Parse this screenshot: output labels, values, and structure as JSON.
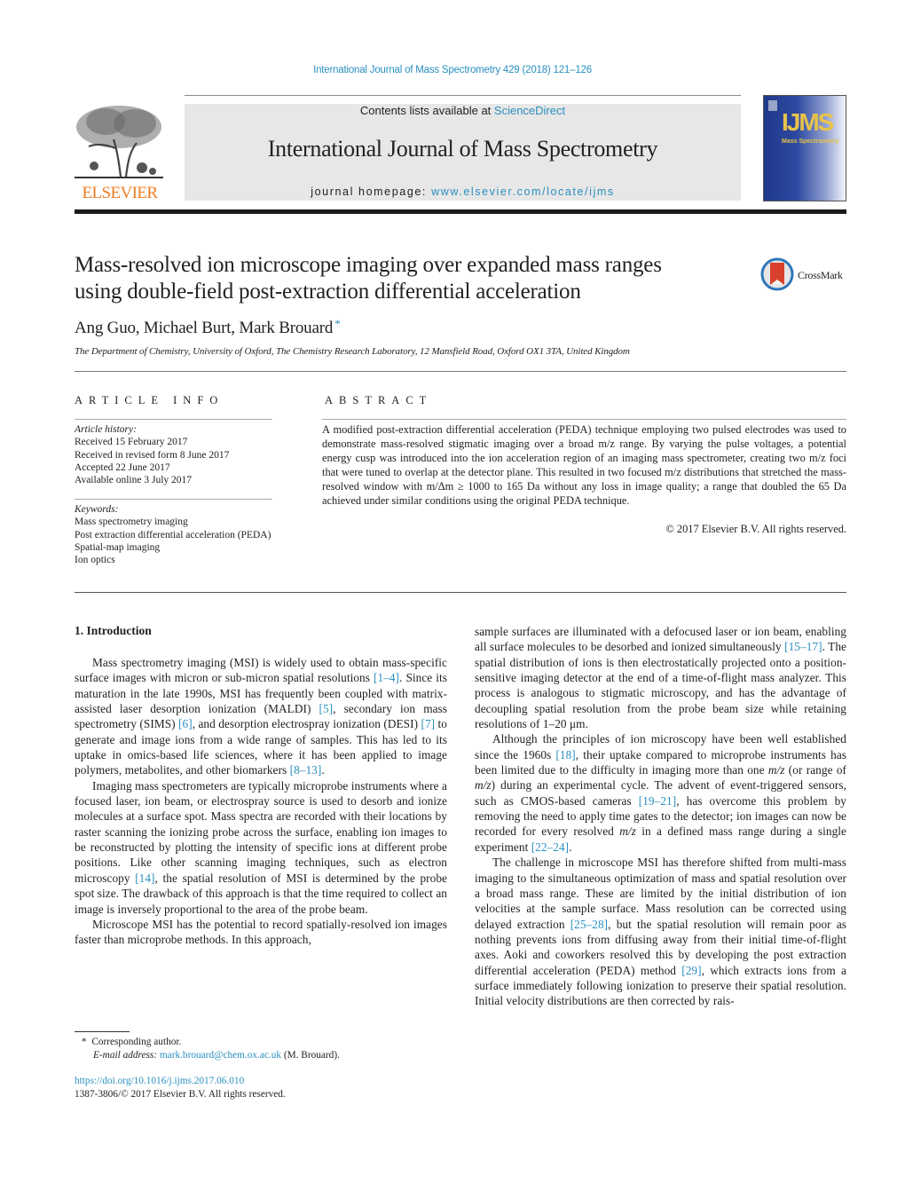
{
  "running_head": "International Journal of Mass Spectrometry 429 (2018) 121–126",
  "masthead": {
    "publisher_logo_text": "ELSEVIER",
    "contents_prefix": "Contents lists available at ",
    "contents_link": "ScienceDirect",
    "journal_title": "International Journal of Mass Spectrometry",
    "homepage_prefix": "journal homepage: ",
    "homepage_link": "www.elsevier.com/locate/ijms",
    "cover_logo": "IJMS",
    "cover_subtitle": "Mass Spectrometry",
    "colors": {
      "link": "#2a8fc0",
      "elsevier_orange": "#f07c1e",
      "band": "#e7e7e7",
      "cover_blue": "#1f3a8a"
    }
  },
  "article": {
    "title_line1": "Mass-resolved ion microscope imaging over expanded mass ranges",
    "title_line2": "using double-field post-extraction differential acceleration",
    "crossmark_label": "CrossMark",
    "authors": "Ang Guo, Michael Burt, Mark Brouard",
    "corresponding_mark": "*",
    "affiliation": "The Department of Chemistry, University of Oxford, The Chemistry Research Laboratory, 12 Mansfield Road, Oxford OX1 3TA, United Kingdom"
  },
  "article_info": {
    "label": "ARTICLE INFO",
    "history_header": "Article history:",
    "history": [
      "Received 15 February 2017",
      "Received in revised form 8 June 2017",
      "Accepted 22 June 2017",
      "Available online 3 July 2017"
    ],
    "keywords_header": "Keywords:",
    "keywords": [
      "Mass spectrometry imaging",
      "Post extraction differential acceleration (PEDA)",
      "Spatial-map imaging",
      "Ion optics"
    ]
  },
  "abstract": {
    "label": "ABSTRACT",
    "text": "A modified post-extraction differential acceleration (PEDA) technique employing two pulsed electrodes was used to demonstrate mass-resolved stigmatic imaging over a broad m/z range. By varying the pulse voltages, a potential energy cusp was introduced into the ion acceleration region of an imaging mass spectrometer, creating two m/z foci that were tuned to overlap at the detector plane. This resulted in two focused m/z distributions that stretched the mass-resolved window with m/Δm ≥ 1000 to 165 Da without any loss in image quality; a range that doubled the 65 Da achieved under similar conditions using the original PEDA technique.",
    "copyright": "© 2017 Elsevier B.V. All rights reserved."
  },
  "body": {
    "section_heading": "1.  Introduction",
    "left_paragraphs": [
      [
        {
          "t": "Mass spectrometry imaging (MSI) is widely used to obtain mass-specific surface images with micron or sub-micron spatial resolutions "
        },
        {
          "c": "[1–4]"
        },
        {
          "t": ". Since its maturation in the late 1990s, MSI has frequently been coupled with matrix-assisted laser desorption ionization (MALDI) "
        },
        {
          "c": "[5]"
        },
        {
          "t": ", secondary ion mass spectrometry (SIMS) "
        },
        {
          "c": "[6]"
        },
        {
          "t": ", and desorption electrospray ionization (DESI) "
        },
        {
          "c": "[7]"
        },
        {
          "t": " to generate and image ions from a wide range of samples. This has led to its uptake in omics-based life sciences, where it has been applied to image polymers, metabolites, and other biomarkers "
        },
        {
          "c": "[8–13]"
        },
        {
          "t": "."
        }
      ],
      [
        {
          "t": "Imaging mass spectrometers are typically microprobe instruments where a focused laser, ion beam, or electrospray source is used to desorb and ionize molecules at a surface spot. Mass spectra are recorded with their locations by raster scanning the ionizing probe across the surface, enabling ion images to be reconstructed by plotting the intensity of specific ions at different probe positions. Like other scanning imaging techniques, such as electron microscopy "
        },
        {
          "c": "[14]"
        },
        {
          "t": ", the spatial resolution of MSI is determined by the probe spot size. The drawback of this approach is that the time required to collect an image is inversely proportional to the area of the probe beam."
        }
      ],
      [
        {
          "t": "Microscope MSI has the potential to record spatially-resolved ion images faster than microprobe methods. In this approach,"
        }
      ]
    ],
    "right_paragraphs": [
      [
        {
          "t": "sample surfaces are illuminated with a defocused laser or ion beam, enabling all surface molecules to be desorbed and ionized simultaneously "
        },
        {
          "c": "[15–17]"
        },
        {
          "t": ". The spatial distribution of ions is then electrostatically projected onto a position-sensitive imaging detector at the end of a time-of-flight mass analyzer. This process is analogous to stigmatic microscopy, and has the advantage of decoupling spatial resolution from the probe beam size while retaining resolutions of 1–20 μm."
        }
      ],
      [
        {
          "t": "Although the principles of ion microscopy have been well established since the 1960s "
        },
        {
          "c": "[18]"
        },
        {
          "t": ", their uptake compared to microprobe instruments has been limited due to the difficulty in imaging more than one "
        },
        {
          "i": "m/z"
        },
        {
          "t": " (or range of "
        },
        {
          "i": "m/z"
        },
        {
          "t": ") during an experimental cycle. The advent of event-triggered sensors, such as CMOS-based cameras "
        },
        {
          "c": "[19–21]"
        },
        {
          "t": ", has overcome this problem by removing the need to apply time gates to the detector; ion images can now be recorded for every resolved "
        },
        {
          "i": "m/z"
        },
        {
          "t": " in a defined mass range during a single experiment "
        },
        {
          "c": "[22–24]"
        },
        {
          "t": "."
        }
      ],
      [
        {
          "t": "The challenge in microscope MSI has therefore shifted from multi-mass imaging to the simultaneous optimization of mass and spatial resolution over a broad mass range. These are limited by the initial distribution of ion velocities at the sample surface. Mass resolution can be corrected using delayed extraction "
        },
        {
          "c": "[25–28]"
        },
        {
          "t": ", but the spatial resolution will remain poor as nothing prevents ions from diffusing away from their initial time-of-flight axes. Aoki and coworkers resolved this by developing the post extraction differential acceleration (PEDA) method "
        },
        {
          "c": "[29]"
        },
        {
          "t": ", which extracts ions from a surface immediately following ionization to preserve their spatial resolution. Initial velocity distributions are then corrected by rais-"
        }
      ]
    ]
  },
  "footnote": {
    "marker": "*",
    "corresponding": "Corresponding author.",
    "email_label": "E-mail address:",
    "email": "mark.brouard@chem.ox.ac.uk",
    "email_suffix": " (M. Brouard)."
  },
  "doi": {
    "url": "https://doi.org/10.1016/j.ijms.2017.06.010",
    "issn_line": "1387-3806/© 2017 Elsevier B.V. All rights reserved."
  }
}
